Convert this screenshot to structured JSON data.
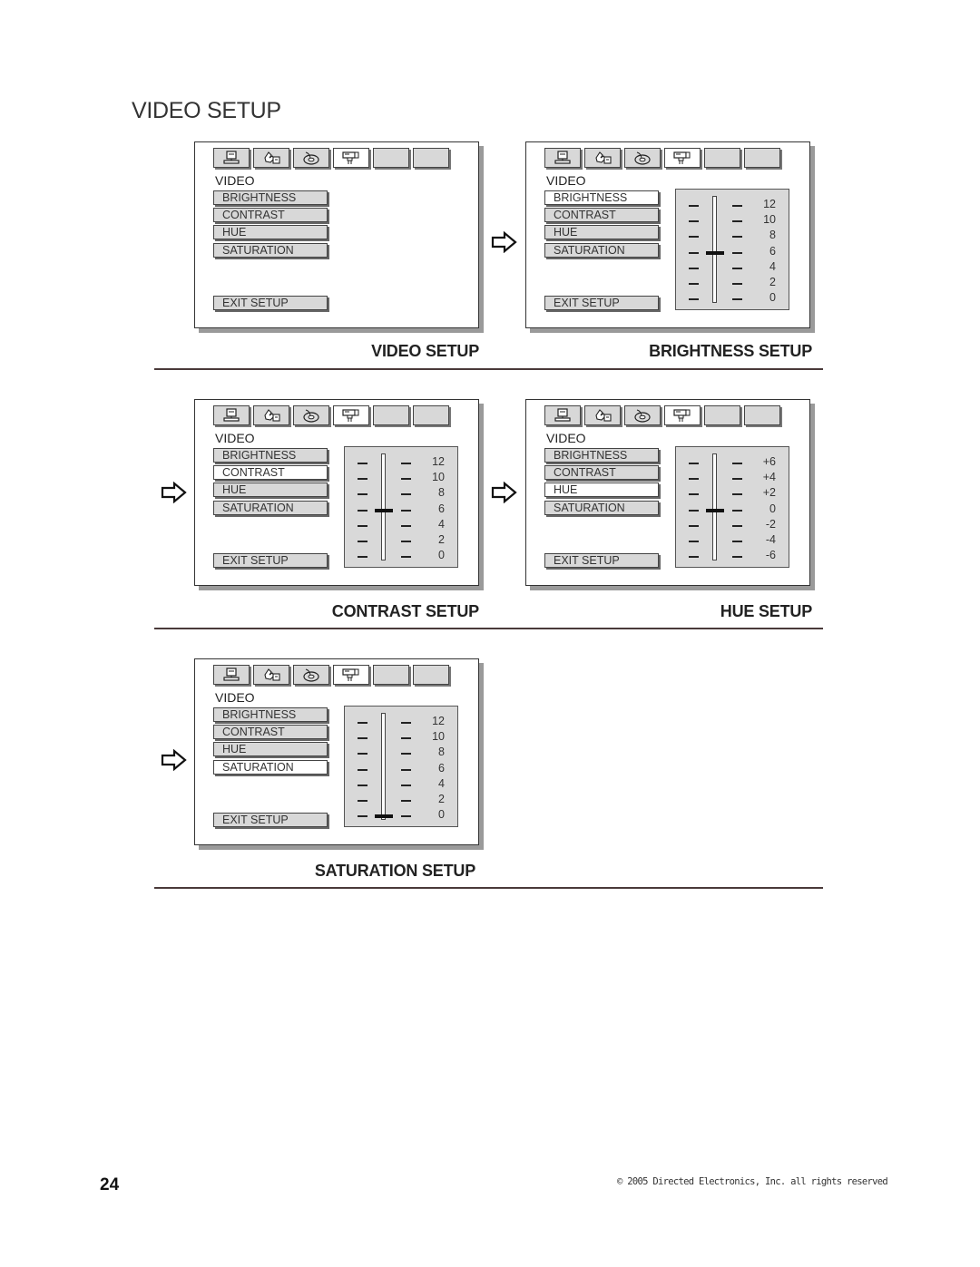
{
  "page": {
    "title": "VIDEO SETUP",
    "page_number": "24",
    "copyright": "© 2005 Directed Electronics, Inc. all rights reserved"
  },
  "icons": {
    "tabs": [
      "monitor-icon",
      "settings-hand-icon",
      "disc-icon",
      "video-camera-icon",
      "blank-tab",
      "blank-tab"
    ],
    "arrow": "right-arrow-outline-icon"
  },
  "menu_labels": {
    "header": "VIDEO",
    "items": [
      "BRIGHTNESS",
      "CONTRAST",
      "HUE",
      "SATURATION"
    ],
    "exit": "EXIT SETUP"
  },
  "panels": [
    {
      "caption": "VIDEO SETUP",
      "selected_item": null,
      "slider": null
    },
    {
      "caption": "BRIGHTNESS SETUP",
      "selected_item": "BRIGHTNESS",
      "slider": {
        "scale": [
          "12",
          "10",
          "8",
          "6",
          "4",
          "2",
          "0"
        ],
        "value": "6",
        "range": [
          0,
          12
        ]
      }
    },
    {
      "caption": "CONTRAST SETUP",
      "selected_item": "CONTRAST",
      "slider": {
        "scale": [
          "12",
          "10",
          "8",
          "6",
          "4",
          "2",
          "0"
        ],
        "value": "6",
        "range": [
          0,
          12
        ]
      }
    },
    {
      "caption": "HUE SETUP",
      "selected_item": "HUE",
      "slider": {
        "scale": [
          "+6",
          "+4",
          "+2",
          "0",
          "-2",
          "-4",
          "-6"
        ],
        "value": "0",
        "range": [
          -6,
          6
        ]
      }
    },
    {
      "caption": "SATURATION SETUP",
      "selected_item": "SATURATION",
      "slider": {
        "scale": [
          "12",
          "10",
          "8",
          "6",
          "4",
          "2",
          "0"
        ],
        "value": "0",
        "range": [
          0,
          12
        ]
      }
    }
  ]
}
